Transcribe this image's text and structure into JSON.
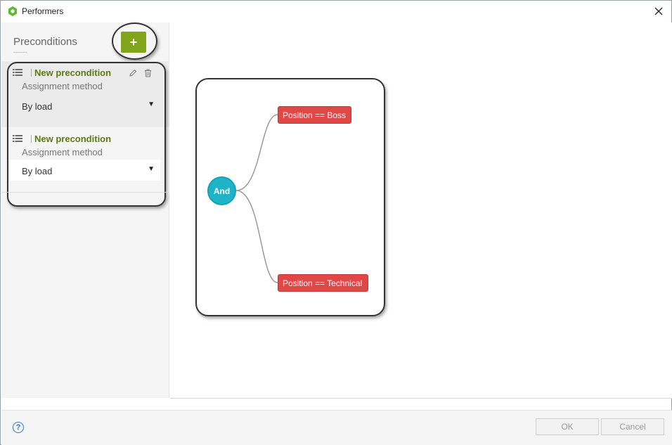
{
  "window": {
    "title": "Performers"
  },
  "sidebar": {
    "title": "Preconditions",
    "add_label": "+",
    "conditions": [
      {
        "title": "New precondition",
        "label": "Assignment method",
        "value": "By load"
      },
      {
        "title": "New precondition",
        "label": "Assignment method",
        "value": "By load"
      }
    ]
  },
  "diagram": {
    "root_label": "And",
    "nodes": [
      "Position == Boss",
      "Position == Technical"
    ]
  },
  "footer": {
    "ok_label": "OK",
    "cancel_label": "Cancel",
    "help_label": "?"
  },
  "colors": {
    "accent_green": "#80a51b",
    "title_green": "#5c7a12",
    "node_red": "#e04848",
    "node_teal": "#1fb3c8"
  },
  "icons": [
    "app-logo-icon",
    "close-icon",
    "list-icon",
    "edit-icon",
    "trash-icon",
    "dropdown-arrow-icon",
    "help-icon"
  ]
}
